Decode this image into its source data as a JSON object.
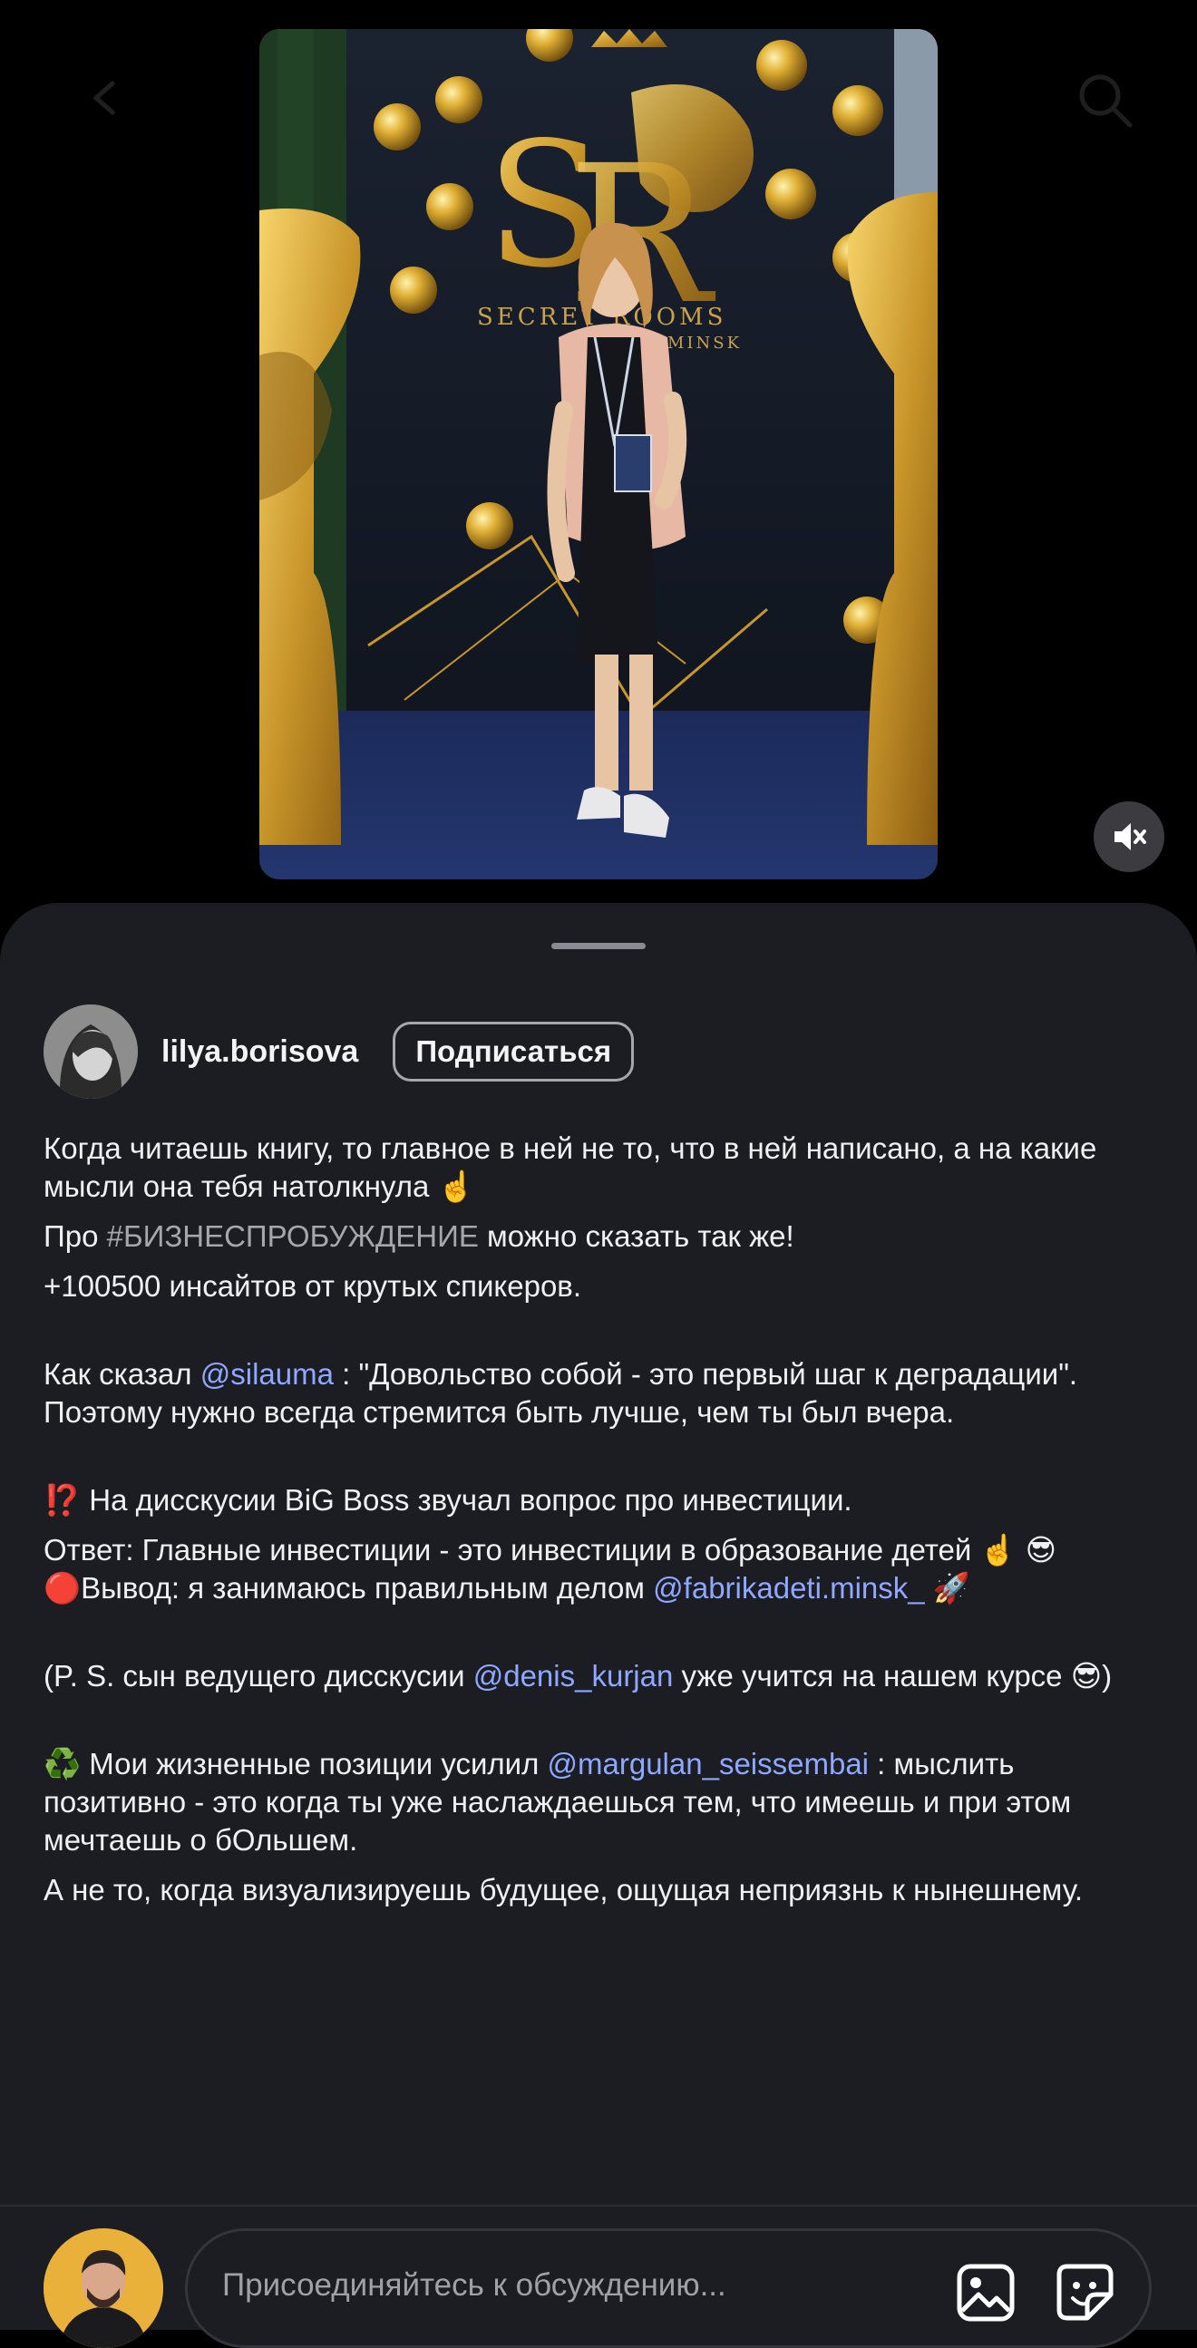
{
  "post": {
    "author": {
      "username": "lilya.borisova",
      "follow_label": "Подписаться"
    },
    "photo": {
      "backdrop_logo_text": "SECRET ROOMS",
      "backdrop_logo_subtext": "MINSK"
    },
    "caption": {
      "p1": "Когда читаешь книгу, то главное в ней не то, что в ней написано, а на какие мысли она тебя натолкнула ☝️",
      "p2_prefix": "Про ",
      "p2_hashtag": "#БИЗНЕСПРОБУЖДЕНИЕ",
      "p2_suffix": " можно сказать так же!",
      "p3": "+100500 инсайтов от крутых спикеров.",
      "p4_prefix": "Как сказал ",
      "p4_mention": "@silauma",
      "p4_suffix": " : \"Довольство собой - это первый шаг к деградации\". Поэтому нужно всегда стремится быть лучше, чем ты был вчера.",
      "p5": "⁉️ На дисскусии BiG Boss звучал вопрос про инвестиции.",
      "p6": "Ответ: Главные инвестиции - это инвестиции в образование детей ☝️ 😎",
      "p7_prefix": "🔴Вывод: я занимаюсь правильным делом ",
      "p7_mention": "@fabrikadeti.minsk_",
      "p7_suffix": " 🚀",
      "p8_prefix": "(P. S. сын ведущего дисскусии ",
      "p8_mention": "@denis_kurjan",
      "p8_suffix": " уже учится на нашем курсе 😎)",
      "p9_prefix": "♻️ Мои жизненные позиции усилил ",
      "p9_mention": "@margulan_seissembai",
      "p9_suffix": " : мыслить позитивно - это когда ты уже наслаждаешься тем, что имеешь и при этом мечтаешь о бОльшем.",
      "p10": " А не то, когда визуализируешь будущее, ощущая неприязнь к нынешнему."
    }
  },
  "comment_bar": {
    "placeholder": "Присоединяйтесь к обсуждению..."
  },
  "icons": {
    "mute": "speaker-muted-icon",
    "gallery": "gallery-icon",
    "sticker": "sticker-icon",
    "back": "chevron-left-icon",
    "search": "search-icon"
  },
  "colors": {
    "sheet_background": "#1c1d22",
    "mention": "#8ea8ff",
    "hashtag": "#a6a7ad"
  }
}
